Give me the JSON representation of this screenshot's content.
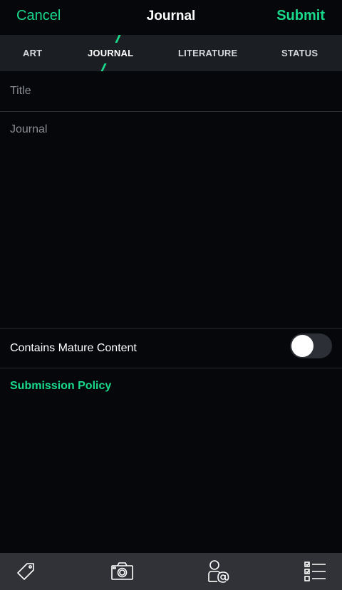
{
  "nav": {
    "cancel_label": "Cancel",
    "title": "Journal",
    "submit_label": "Submit"
  },
  "tabs": [
    {
      "label": "ART",
      "active": false
    },
    {
      "label": "JOURNAL",
      "active": true
    },
    {
      "label": "LITERATURE",
      "active": false
    },
    {
      "label": "STATUS",
      "active": false
    }
  ],
  "form": {
    "title_placeholder": "Title",
    "title_value": "",
    "journal_placeholder": "Journal",
    "journal_value": "",
    "mature_label": "Contains Mature Content",
    "mature_enabled": false,
    "policy_link": "Submission Policy"
  },
  "toolbar": {
    "icons": [
      "tag-icon",
      "camera-icon",
      "mention-user-icon",
      "checklist-icon"
    ]
  },
  "colors": {
    "accent": "#19d98c",
    "background": "#06070b",
    "tabbar": "#1b1e22",
    "bottombar": "#303237"
  }
}
